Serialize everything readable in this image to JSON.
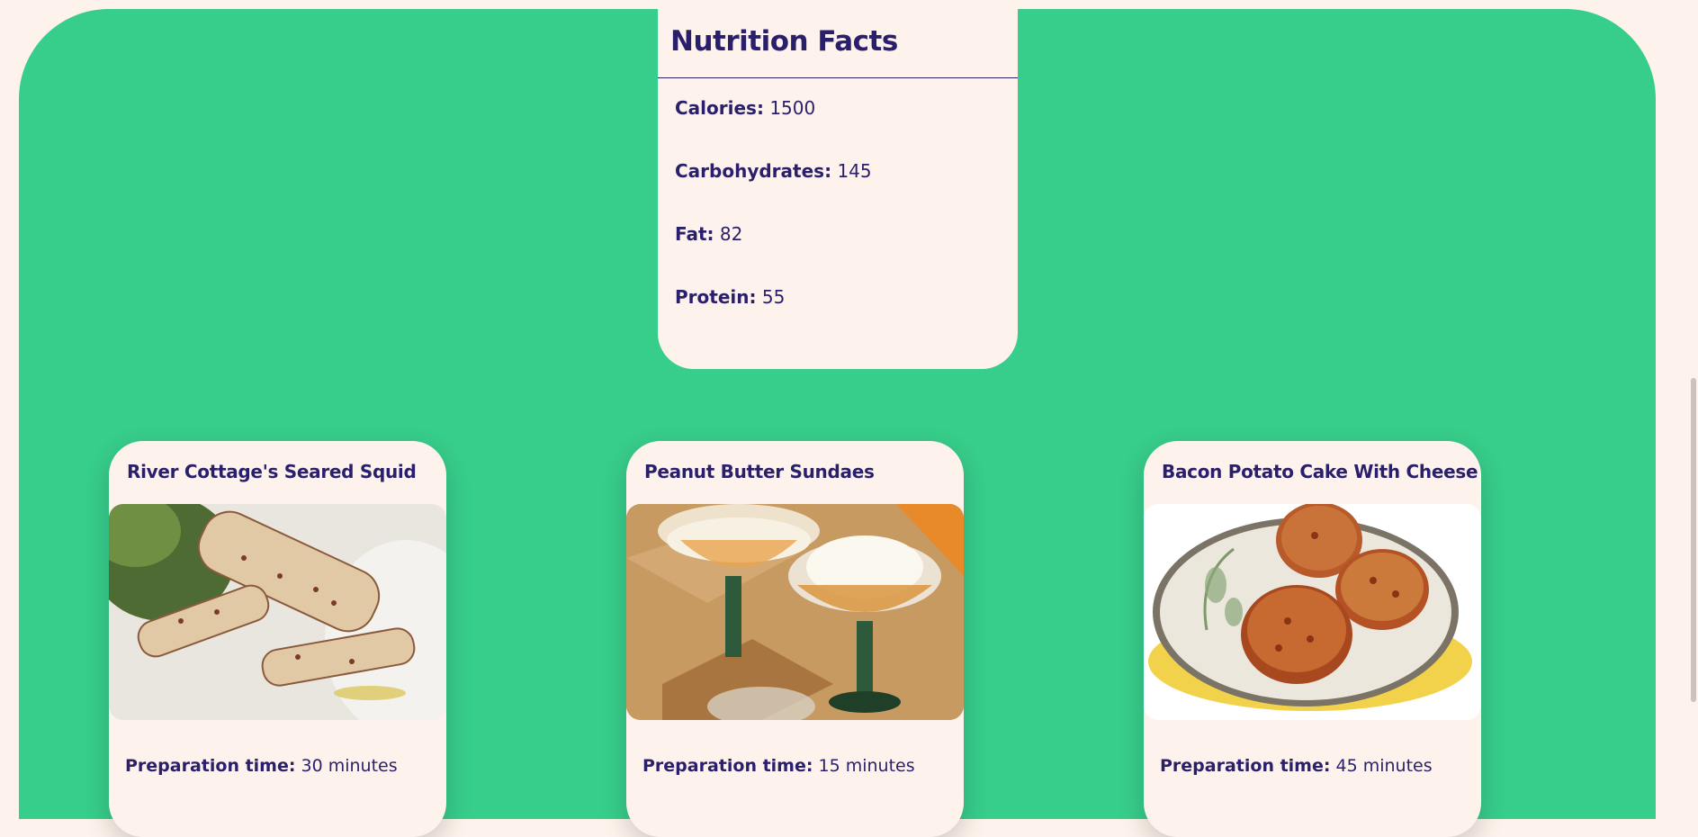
{
  "nutrition": {
    "title": "Nutrition Facts",
    "items": [
      {
        "label": "Calories:",
        "value": "1500"
      },
      {
        "label": "Carbohydrates:",
        "value": "145"
      },
      {
        "label": "Fat:",
        "value": "82"
      },
      {
        "label": "Protein:",
        "value": "55"
      }
    ]
  },
  "recipes": [
    {
      "title": "River Cottage's Seared Squid",
      "prep_label": "Preparation time:",
      "prep_value": "30 minutes",
      "photo": "seared-squid-photo"
    },
    {
      "title": "Peanut Butter Sundaes",
      "prep_label": "Preparation time:",
      "prep_value": "15 minutes",
      "photo": "peanut-butter-sundae-photo"
    },
    {
      "title": "Bacon Potato Cake With Cheese",
      "prep_label": "Preparation time:",
      "prep_value": "45 minutes",
      "photo": "bacon-potato-cake-photo"
    }
  ],
  "colors": {
    "background": "#fdf3ec",
    "accent_green": "#37cd8b",
    "text_primary": "#2a1f6b"
  }
}
